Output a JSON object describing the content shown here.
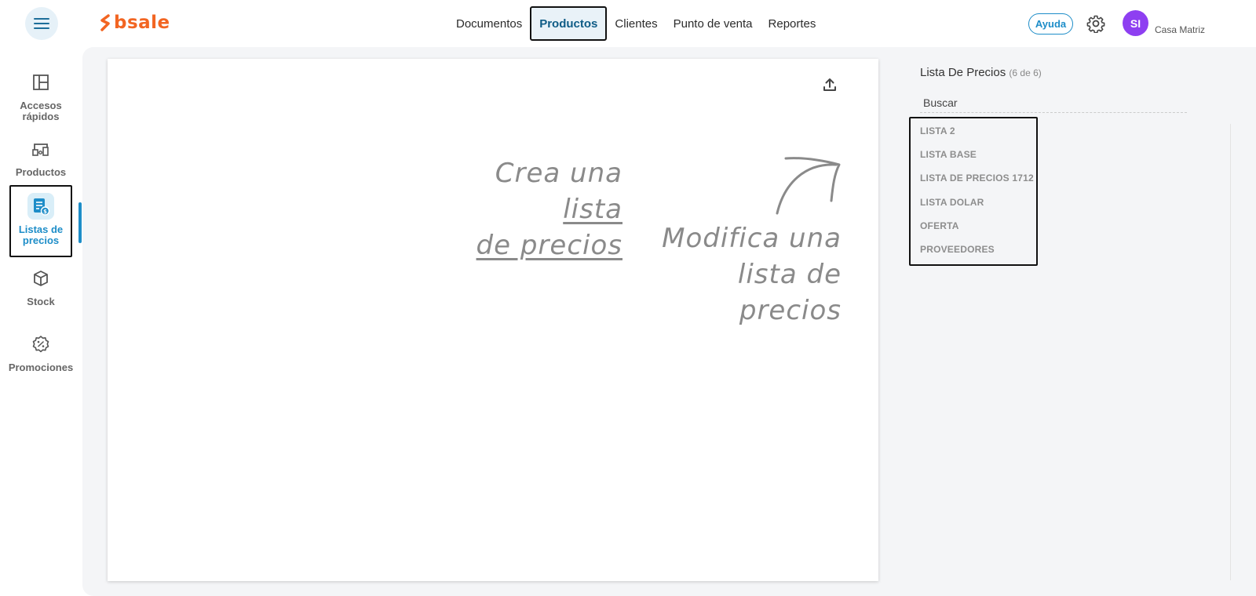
{
  "header": {
    "brand": "bsale",
    "nav": [
      "Documentos",
      "Productos",
      "Clientes",
      "Punto de venta",
      "Reportes"
    ],
    "help_label": "Ayuda",
    "avatar_initials": "SI",
    "branch": "Casa Matriz"
  },
  "sidebar": {
    "items": [
      {
        "label": "Accesos rápidos",
        "icon": "layout-icon"
      },
      {
        "label": "Productos",
        "icon": "products-icon"
      },
      {
        "label": "Listas de precios",
        "icon": "price-list-icon"
      },
      {
        "label": "Stock",
        "icon": "box-icon"
      },
      {
        "label": "Promociones",
        "icon": "percent-badge-icon"
      }
    ]
  },
  "main": {
    "create_line1": "Crea una",
    "create_link1": "lista",
    "create_link2": "de precios",
    "modify_line1": "Modifica una",
    "modify_line2": "lista de precios"
  },
  "panel": {
    "title": "Lista De Precios",
    "count": "(6 de 6)",
    "search_placeholder": "Buscar",
    "lists": [
      "LISTA 2",
      "LISTA BASE",
      "LISTA DE PRECIOS 1712",
      "LISTA DOLAR",
      "OFERTA",
      "PROVEEDORES"
    ]
  },
  "colors": {
    "accent": "#1d8dc8",
    "brand": "#f26522",
    "avatar": "#8e3ff1"
  }
}
